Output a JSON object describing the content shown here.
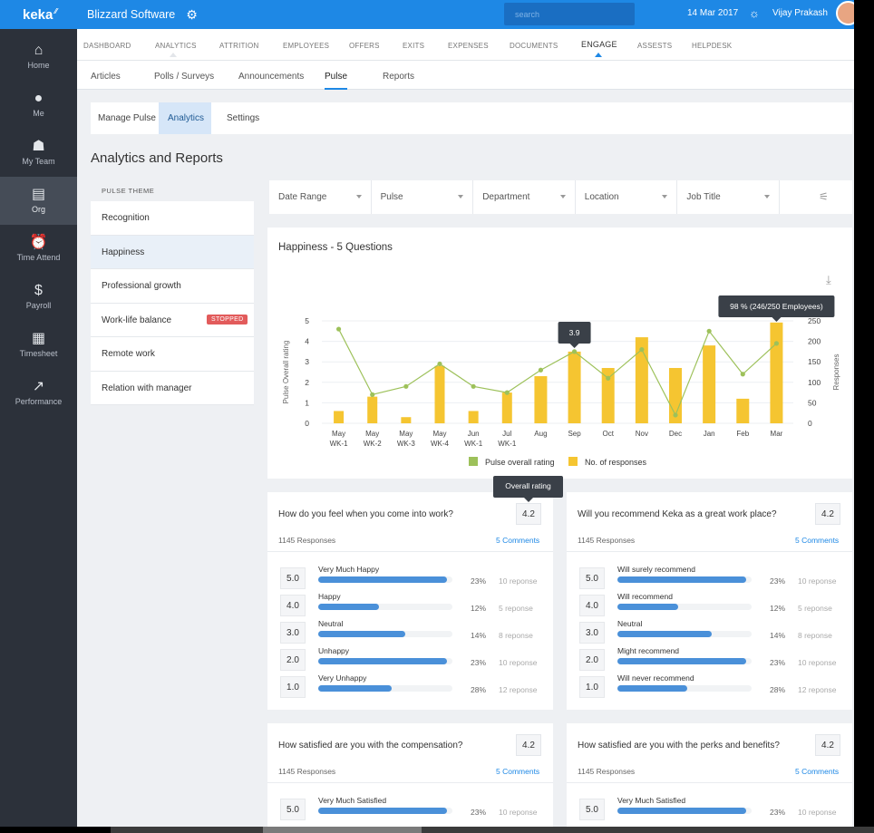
{
  "app": {
    "logo": "keka",
    "company": "Blizzard Software"
  },
  "topbar": {
    "search_placeholder": "search",
    "date": "14 Mar 2017",
    "user": "Vijay Prakash"
  },
  "sidebar": {
    "items": [
      {
        "label": "Home",
        "icon": "home-icon",
        "glyph": "⌂"
      },
      {
        "label": "Me",
        "icon": "user-icon",
        "glyph": "●"
      },
      {
        "label": "My Team",
        "icon": "team-icon",
        "glyph": "☗"
      },
      {
        "label": "Org",
        "icon": "building-icon",
        "glyph": "▤"
      },
      {
        "label": "Time Attend",
        "icon": "alarm-clock-icon",
        "glyph": "⏰"
      },
      {
        "label": "Payroll",
        "icon": "dollar-icon",
        "glyph": "$"
      },
      {
        "label": "Timesheet",
        "icon": "clipboard-icon",
        "glyph": "▦"
      },
      {
        "label": "Performance",
        "icon": "trend-up-icon",
        "glyph": "↗"
      }
    ],
    "active": "Org"
  },
  "mainnav": {
    "items": [
      "DASHBOARD",
      "ANALYTICS",
      "ATTRITION",
      "EMPLOYEES",
      "OFFERS",
      "EXITS",
      "EXPENSES",
      "DOCUMENTS",
      "ENGAGE",
      "ASSESTS",
      "HELPDESK"
    ],
    "active": "ENGAGE"
  },
  "subnav": {
    "items": [
      "Articles",
      "Polls / Surveys",
      "Announcements",
      "Pulse",
      "Reports"
    ],
    "active": "Pulse"
  },
  "tabs": {
    "items": [
      "Manage Pulse",
      "Analytics",
      "Settings"
    ],
    "active": "Analytics"
  },
  "page_title": "Analytics and Reports",
  "themes": {
    "header": "PULSE THEME",
    "items": [
      {
        "label": "Recognition"
      },
      {
        "label": "Happiness"
      },
      {
        "label": "Professional growth"
      },
      {
        "label": "Work-life balance",
        "badge": "STOPPED"
      },
      {
        "label": "Remote work"
      },
      {
        "label": "Relation with manager"
      }
    ],
    "selected": "Happiness"
  },
  "filters": [
    "Date Range",
    "Pulse",
    "Department",
    "Location",
    "Job Title"
  ],
  "chart_data": {
    "type": "bar",
    "title": "Happiness - 5 Questions",
    "categories": [
      "May WK-1",
      "May WK-2",
      "May WK-3",
      "May WK-4",
      "Jun WK-1",
      "Jul WK-1",
      "Aug",
      "Sep",
      "Oct",
      "Nov",
      "Dec",
      "Jan",
      "Feb",
      "Mar"
    ],
    "category_lines": [
      [
        "May",
        "WK-1"
      ],
      [
        "May",
        "WK-2"
      ],
      [
        "May",
        "WK-3"
      ],
      [
        "May",
        "WK-4"
      ],
      [
        "Jun",
        "WK-1"
      ],
      [
        "Jul",
        "WK-1"
      ],
      [
        "Aug"
      ],
      [
        "Sep"
      ],
      [
        "Oct"
      ],
      [
        "Nov"
      ],
      [
        "Dec"
      ],
      [
        "Jan"
      ],
      [
        "Feb"
      ],
      [
        "Mar"
      ]
    ],
    "ylabel": "Pulse Overall rating",
    "y2label": "Responses",
    "ylim": [
      0,
      5
    ],
    "y2lim": [
      0,
      250
    ],
    "yticks": [
      0,
      1,
      2,
      3,
      4,
      5
    ],
    "y2ticks": [
      0,
      50,
      100,
      150,
      200,
      250
    ],
    "series": [
      {
        "name": "No. of responses",
        "type": "bar",
        "color": "#f5c531",
        "axis": "right",
        "values": [
          30,
          65,
          15,
          140,
          30,
          75,
          115,
          175,
          135,
          210,
          135,
          190,
          60,
          246
        ]
      },
      {
        "name": "Pulse overall rating",
        "type": "line",
        "color": "#9dc15a",
        "axis": "left",
        "values": [
          4.6,
          1.4,
          1.8,
          2.9,
          1.8,
          1.5,
          2.6,
          3.5,
          2.2,
          3.6,
          0.4,
          4.5,
          2.4,
          3.9
        ]
      }
    ],
    "annotations": [
      {
        "text": "3.9",
        "category": "Sep"
      },
      {
        "text": "98 % (246/250 Employees)",
        "category": "Mar"
      }
    ],
    "legend_position": "bottom"
  },
  "tooltip_overall": "Overall rating",
  "questions": [
    {
      "q": "How do you feel when you come into work?",
      "score": "4.2",
      "responses": "1145 Responses",
      "comments": "5 Comments",
      "answers": [
        {
          "v": "5.0",
          "label": "Very Much Happy",
          "pct": "23%",
          "fill": 0.96,
          "count": "10 reponse"
        },
        {
          "v": "4.0",
          "label": "Happy",
          "pct": "12%",
          "fill": 0.45,
          "count": "5 reponse"
        },
        {
          "v": "3.0",
          "label": "Neutral",
          "pct": "14%",
          "fill": 0.65,
          "count": "8 reponse"
        },
        {
          "v": "2.0",
          "label": "Unhappy",
          "pct": "23%",
          "fill": 0.96,
          "count": "10 reponse"
        },
        {
          "v": "1.0",
          "label": "Very Unhappy",
          "pct": "28%",
          "fill": 0.55,
          "count": "12 reponse"
        }
      ]
    },
    {
      "q": "Will you recommend Keka as a great work place?",
      "score": "4.2",
      "responses": "1145 Responses",
      "comments": "5 Comments",
      "answers": [
        {
          "v": "5.0",
          "label": "Will surely recommend",
          "pct": "23%",
          "fill": 0.96,
          "count": "10 reponse"
        },
        {
          "v": "4.0",
          "label": "Will recommend",
          "pct": "12%",
          "fill": 0.45,
          "count": "5 reponse"
        },
        {
          "v": "3.0",
          "label": "Neutral",
          "pct": "14%",
          "fill": 0.7,
          "count": "8 reponse"
        },
        {
          "v": "2.0",
          "label": "Might recommend",
          "pct": "23%",
          "fill": 0.96,
          "count": "10 reponse"
        },
        {
          "v": "1.0",
          "label": "Will never recommend",
          "pct": "28%",
          "fill": 0.52,
          "count": "12 reponse"
        }
      ]
    },
    {
      "q": "How satisfied are you with the compensation?",
      "score": "4.2",
      "responses": "1145 Responses",
      "comments": "5 Comments",
      "answers": [
        {
          "v": "5.0",
          "label": "Very Much Satisfied",
          "pct": "23%",
          "fill": 0.96,
          "count": "10 reponse"
        }
      ]
    },
    {
      "q": "How satisfied are you with the perks and benefits?",
      "score": "4.2",
      "responses": "1145 Responses",
      "comments": "5 Comments",
      "answers": [
        {
          "v": "5.0",
          "label": "Very Much Satisfied",
          "pct": "23%",
          "fill": 0.96,
          "count": "10 reponse"
        }
      ]
    }
  ]
}
